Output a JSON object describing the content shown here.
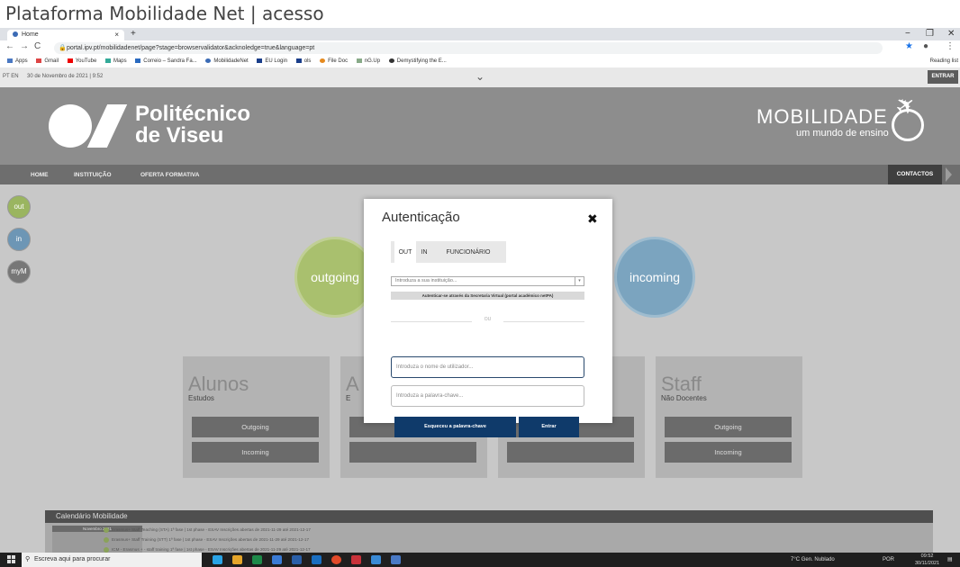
{
  "caption": "Plataforma Mobilidade Net | acesso",
  "browser": {
    "tab_label": "Home",
    "tab_close": "×",
    "new_tab": "+",
    "url": "portal.ipv.pt/mobilidadenet/page?stage=browservalidator&acknoledge=true&language=pt",
    "win_min": "−",
    "win_max": "❐",
    "win_close": "✕",
    "bookmarks": [
      "Apps",
      "Gmail",
      "YouTube",
      "Maps",
      "Correio – Sandra Fa...",
      "MobilidadeNet",
      "EU Login",
      "ols",
      "File Doc",
      "nG.Up",
      "Demystifying the E..."
    ],
    "reading_list": "Reading list"
  },
  "topbar": {
    "lang": "PT EN",
    "date": "30 de Novembro de 2021 | 9:52",
    "entrar": "ENTRAR"
  },
  "header": {
    "logo_line1": "Politécnico",
    "logo_line2": "de Viseu",
    "mobility_title": "MOBILIDADE",
    "mobility_sub": "um mundo de ensino"
  },
  "nav": {
    "items": [
      "HOME",
      "INSTITUIÇÃO",
      "OFERTA FORMATIVA"
    ],
    "contactos": "CONTACTOS"
  },
  "side_buttons": [
    "out",
    "in",
    "myM"
  ],
  "circles": {
    "outgoing": "outgoing",
    "incoming": "incoming"
  },
  "cards": [
    {
      "title": "Alunos",
      "sub": "Estudos",
      "btn1": "Outgoing",
      "btn2": "Incoming"
    },
    {
      "title": "A",
      "sub": "E",
      "btn1": "",
      "btn2": ""
    },
    {
      "title": "",
      "sub": "",
      "btn1": "",
      "btn2": ""
    },
    {
      "title": "Staff",
      "sub": "Não Docentes",
      "btn1": "Outgoing",
      "btn2": "Incoming"
    }
  ],
  "calendar": {
    "title": "Calendário Mobilidade",
    "month": "Novembro 2021",
    "rows": [
      "Erasmus+ Staff Teaching (STA) 1ª fase | 1st phase - ESAV  Inscrições abertas de 2021-11-29 até 2021-12-17",
      "Erasmus+ Staff Training (STT) 1ª fase | 1st phase - ESAV  Inscrições abertas de 2021-11-29 até 2021-12-17",
      "ICM - Erasmus + - staff training 1ª fase | 1st phase - ESAV  Inscrições abertas de 2021-11-29 até 2021-12-17"
    ]
  },
  "modal": {
    "title": "Autenticação",
    "close": "✖",
    "tabs": [
      "OUT",
      "IN",
      "FUNCIONÁRIO"
    ],
    "institution_placeholder": "Introduza a sua instituição...",
    "virtual_secretary": "Autenticar-se através da Secretaria Virtual (portal académico netPA)",
    "or": "OU",
    "username_placeholder": "Introduza o nome de utilizador...",
    "password_placeholder": "Introduza a palavra-chave...",
    "forgot_button": "Esqueceu a palavra-chave",
    "login_button": "Entrar"
  },
  "taskbar": {
    "search": "Escreva aqui para procurar",
    "weather": "7°C Gen. Nublado",
    "lang": "POR",
    "time": "09:52",
    "date": "30/11/2021"
  }
}
